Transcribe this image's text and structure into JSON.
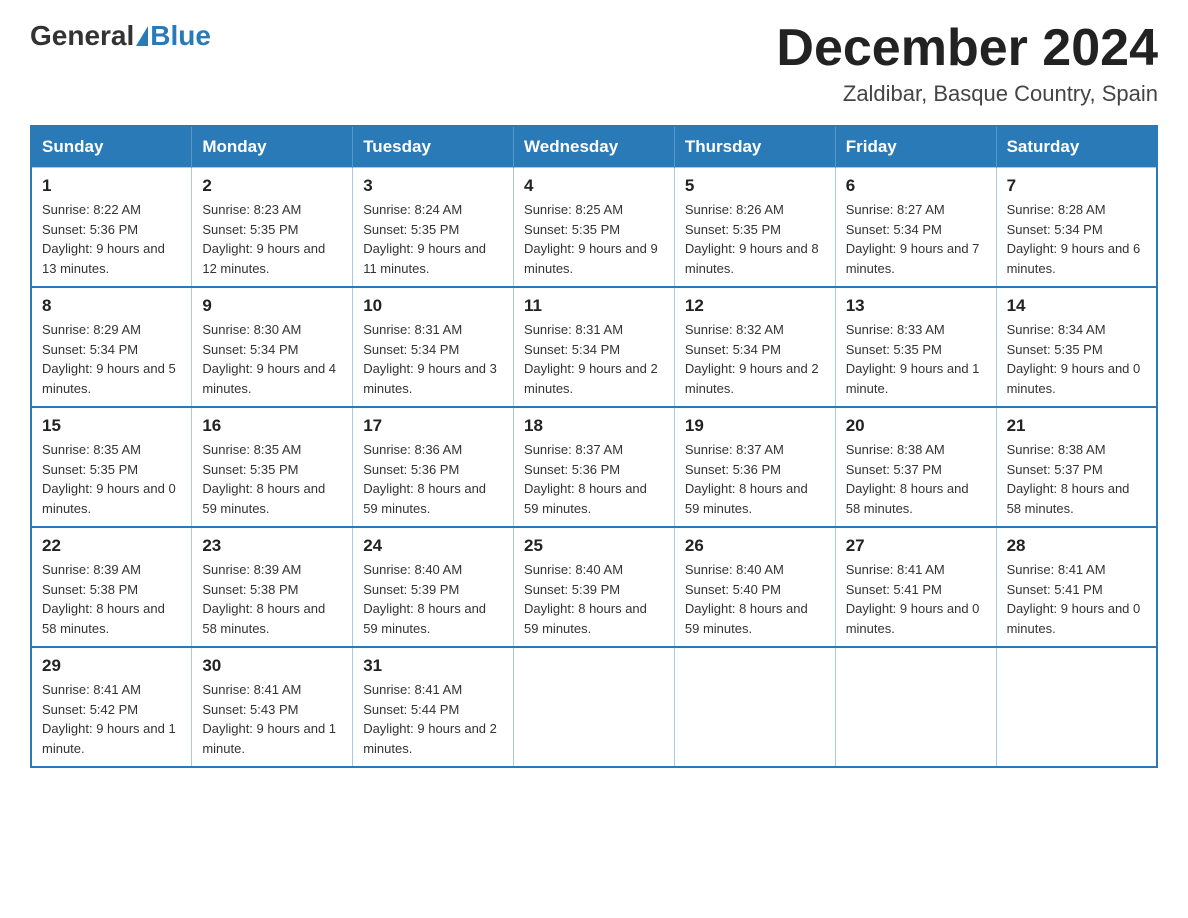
{
  "header": {
    "logo_general": "General",
    "logo_blue": "Blue",
    "month_title": "December 2024",
    "location": "Zaldibar, Basque Country, Spain"
  },
  "columns": [
    "Sunday",
    "Monday",
    "Tuesday",
    "Wednesday",
    "Thursday",
    "Friday",
    "Saturday"
  ],
  "weeks": [
    [
      {
        "day": "1",
        "sunrise": "8:22 AM",
        "sunset": "5:36 PM",
        "daylight": "9 hours and 13 minutes."
      },
      {
        "day": "2",
        "sunrise": "8:23 AM",
        "sunset": "5:35 PM",
        "daylight": "9 hours and 12 minutes."
      },
      {
        "day": "3",
        "sunrise": "8:24 AM",
        "sunset": "5:35 PM",
        "daylight": "9 hours and 11 minutes."
      },
      {
        "day": "4",
        "sunrise": "8:25 AM",
        "sunset": "5:35 PM",
        "daylight": "9 hours and 9 minutes."
      },
      {
        "day": "5",
        "sunrise": "8:26 AM",
        "sunset": "5:35 PM",
        "daylight": "9 hours and 8 minutes."
      },
      {
        "day": "6",
        "sunrise": "8:27 AM",
        "sunset": "5:34 PM",
        "daylight": "9 hours and 7 minutes."
      },
      {
        "day": "7",
        "sunrise": "8:28 AM",
        "sunset": "5:34 PM",
        "daylight": "9 hours and 6 minutes."
      }
    ],
    [
      {
        "day": "8",
        "sunrise": "8:29 AM",
        "sunset": "5:34 PM",
        "daylight": "9 hours and 5 minutes."
      },
      {
        "day": "9",
        "sunrise": "8:30 AM",
        "sunset": "5:34 PM",
        "daylight": "9 hours and 4 minutes."
      },
      {
        "day": "10",
        "sunrise": "8:31 AM",
        "sunset": "5:34 PM",
        "daylight": "9 hours and 3 minutes."
      },
      {
        "day": "11",
        "sunrise": "8:31 AM",
        "sunset": "5:34 PM",
        "daylight": "9 hours and 2 minutes."
      },
      {
        "day": "12",
        "sunrise": "8:32 AM",
        "sunset": "5:34 PM",
        "daylight": "9 hours and 2 minutes."
      },
      {
        "day": "13",
        "sunrise": "8:33 AM",
        "sunset": "5:35 PM",
        "daylight": "9 hours and 1 minute."
      },
      {
        "day": "14",
        "sunrise": "8:34 AM",
        "sunset": "5:35 PM",
        "daylight": "9 hours and 0 minutes."
      }
    ],
    [
      {
        "day": "15",
        "sunrise": "8:35 AM",
        "sunset": "5:35 PM",
        "daylight": "9 hours and 0 minutes."
      },
      {
        "day": "16",
        "sunrise": "8:35 AM",
        "sunset": "5:35 PM",
        "daylight": "8 hours and 59 minutes."
      },
      {
        "day": "17",
        "sunrise": "8:36 AM",
        "sunset": "5:36 PM",
        "daylight": "8 hours and 59 minutes."
      },
      {
        "day": "18",
        "sunrise": "8:37 AM",
        "sunset": "5:36 PM",
        "daylight": "8 hours and 59 minutes."
      },
      {
        "day": "19",
        "sunrise": "8:37 AM",
        "sunset": "5:36 PM",
        "daylight": "8 hours and 59 minutes."
      },
      {
        "day": "20",
        "sunrise": "8:38 AM",
        "sunset": "5:37 PM",
        "daylight": "8 hours and 58 minutes."
      },
      {
        "day": "21",
        "sunrise": "8:38 AM",
        "sunset": "5:37 PM",
        "daylight": "8 hours and 58 minutes."
      }
    ],
    [
      {
        "day": "22",
        "sunrise": "8:39 AM",
        "sunset": "5:38 PM",
        "daylight": "8 hours and 58 minutes."
      },
      {
        "day": "23",
        "sunrise": "8:39 AM",
        "sunset": "5:38 PM",
        "daylight": "8 hours and 58 minutes."
      },
      {
        "day": "24",
        "sunrise": "8:40 AM",
        "sunset": "5:39 PM",
        "daylight": "8 hours and 59 minutes."
      },
      {
        "day": "25",
        "sunrise": "8:40 AM",
        "sunset": "5:39 PM",
        "daylight": "8 hours and 59 minutes."
      },
      {
        "day": "26",
        "sunrise": "8:40 AM",
        "sunset": "5:40 PM",
        "daylight": "8 hours and 59 minutes."
      },
      {
        "day": "27",
        "sunrise": "8:41 AM",
        "sunset": "5:41 PM",
        "daylight": "9 hours and 0 minutes."
      },
      {
        "day": "28",
        "sunrise": "8:41 AM",
        "sunset": "5:41 PM",
        "daylight": "9 hours and 0 minutes."
      }
    ],
    [
      {
        "day": "29",
        "sunrise": "8:41 AM",
        "sunset": "5:42 PM",
        "daylight": "9 hours and 1 minute."
      },
      {
        "day": "30",
        "sunrise": "8:41 AM",
        "sunset": "5:43 PM",
        "daylight": "9 hours and 1 minute."
      },
      {
        "day": "31",
        "sunrise": "8:41 AM",
        "sunset": "5:44 PM",
        "daylight": "9 hours and 2 minutes."
      },
      null,
      null,
      null,
      null
    ]
  ],
  "labels": {
    "sunrise": "Sunrise:",
    "sunset": "Sunset:",
    "daylight": "Daylight:"
  }
}
